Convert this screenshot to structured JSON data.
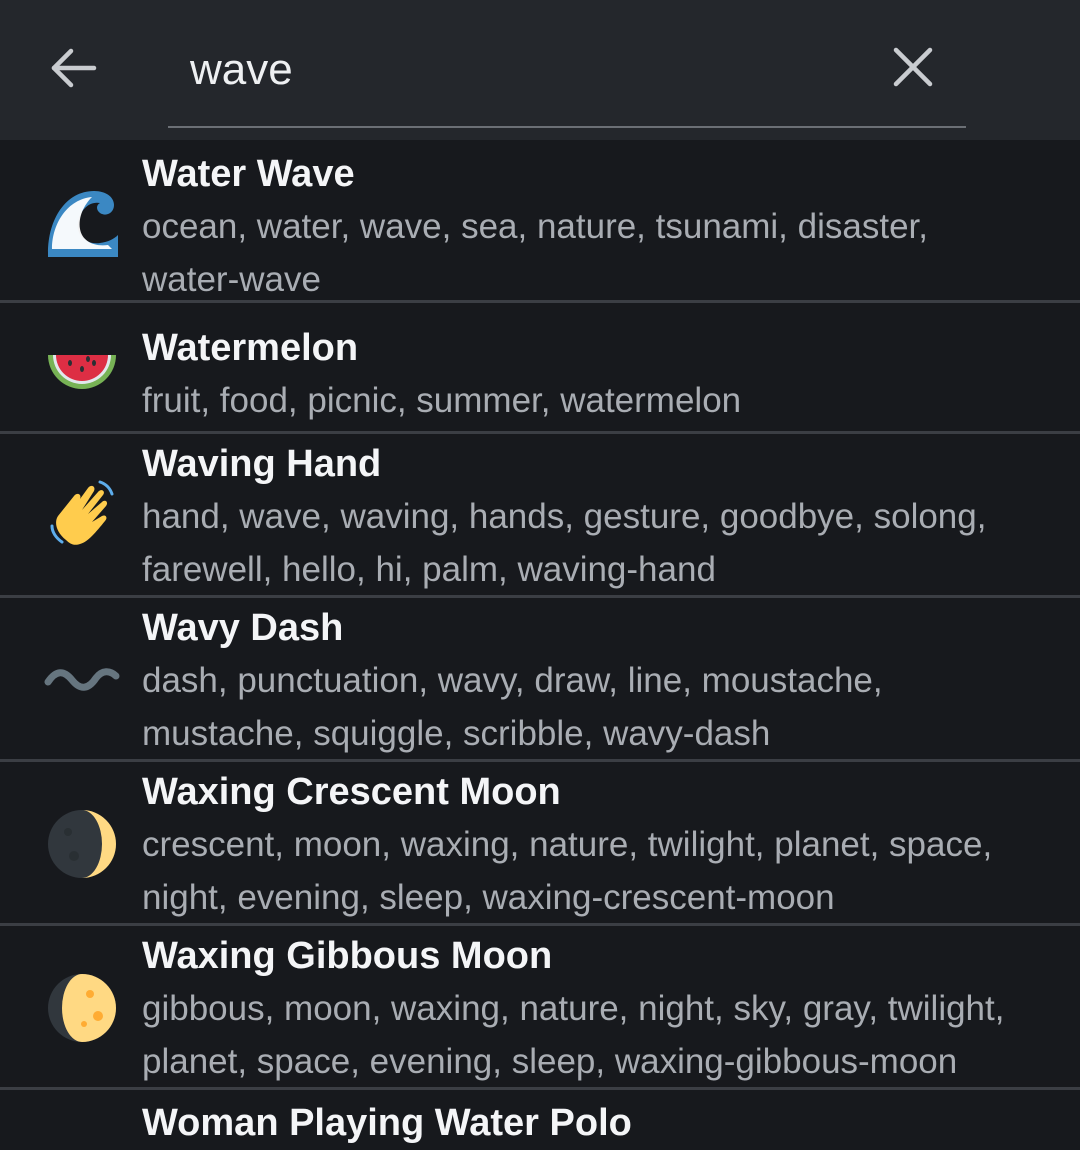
{
  "search": {
    "query": "wave",
    "back_icon": "arrow-left-icon",
    "clear_icon": "close-icon"
  },
  "results": [
    {
      "icon": "water-wave-emoji",
      "title": "Water Wave",
      "tags_line1": "ocean, water, wave, sea, nature, tsunami, disaster,",
      "tags_line2": "water-wave"
    },
    {
      "icon": "watermelon-emoji",
      "title": "Watermelon",
      "tags_line1": "fruit, food, picnic, summer, watermelon",
      "tags_line2": ""
    },
    {
      "icon": "waving-hand-emoji",
      "title": "Waving Hand",
      "tags_line1": "hand, wave, waving, hands, gesture, goodbye, solong,",
      "tags_line2": "farewell, hello, hi, palm, waving-hand"
    },
    {
      "icon": "wavy-dash-emoji",
      "title": "Wavy Dash",
      "tags_line1": "dash, punctuation, wavy, draw, line, moustache,",
      "tags_line2": "mustache, squiggle, scribble, wavy-dash"
    },
    {
      "icon": "waxing-crescent-moon-emoji",
      "title": "Waxing Crescent Moon",
      "tags_line1": "crescent, moon, waxing, nature, twilight, planet, space,",
      "tags_line2": "night, evening, sleep, waxing-crescent-moon"
    },
    {
      "icon": "waxing-gibbous-moon-emoji",
      "title": "Waxing Gibbous Moon",
      "tags_line1": "gibbous, moon, waxing, nature, night, sky, gray, twilight,",
      "tags_line2": "planet, space, evening, sleep, waxing-gibbous-moon"
    },
    {
      "icon": "woman-playing-water-polo-emoji",
      "title": "Woman Playing Water Polo",
      "tags_line1": "",
      "tags_line2": ""
    }
  ],
  "colors": {
    "background": "#17191d",
    "topbar": "#24272c",
    "title_text": "#f4f5f7",
    "tag_text": "#a9adb3",
    "divider": "#3b3e44"
  }
}
